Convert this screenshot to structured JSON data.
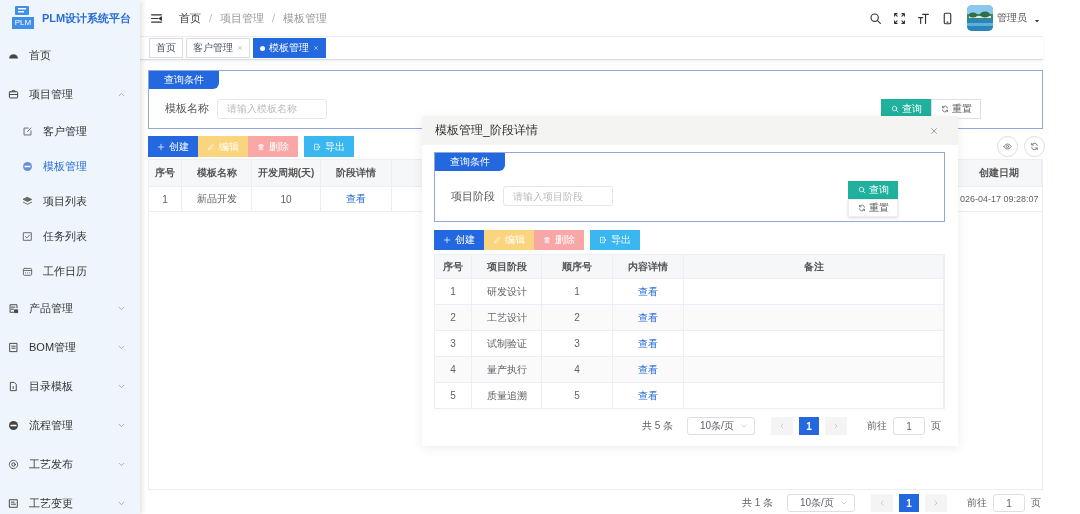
{
  "sidebar": {
    "logo_text": "PLM",
    "title": "PLM设计系统平台",
    "items": [
      {
        "label": "首页",
        "kind": "link",
        "selected": false
      },
      {
        "label": "项目管理",
        "kind": "group",
        "selected": false,
        "expanded": true,
        "children": [
          {
            "label": "客户管理",
            "selected": false
          },
          {
            "label": "模板管理",
            "selected": true
          },
          {
            "label": "项目列表",
            "selected": false
          },
          {
            "label": "任务列表",
            "selected": false
          },
          {
            "label": "工作日历",
            "selected": false
          }
        ]
      },
      {
        "label": "产品管理",
        "kind": "group",
        "selected": false,
        "expanded": false
      },
      {
        "label": "BOM管理",
        "kind": "group",
        "selected": false,
        "expanded": false
      },
      {
        "label": "目录模板",
        "kind": "group",
        "selected": false,
        "expanded": false
      },
      {
        "label": "流程管理",
        "kind": "group",
        "selected": false,
        "expanded": false
      },
      {
        "label": "工艺发布",
        "kind": "group",
        "selected": false,
        "expanded": false
      },
      {
        "label": "工艺变更",
        "kind": "group",
        "selected": false,
        "expanded": false
      }
    ]
  },
  "header": {
    "breadcrumb": [
      "首页",
      "项目管理",
      "模板管理"
    ],
    "separator": "/",
    "user": "管理员"
  },
  "tabs": [
    {
      "label": "首页",
      "selected": false,
      "closable": false
    },
    {
      "label": "客户管理",
      "selected": false,
      "closable": true
    },
    {
      "label": "模板管理",
      "selected": true,
      "closable": true
    }
  ],
  "page": {
    "query": {
      "tab": "查询条件",
      "label": "模板名称",
      "placeholder": "请输入模板名称",
      "buttons": [
        {
          "label": "查询",
          "kind": "primary"
        },
        {
          "label": "重置",
          "kind": "default"
        }
      ]
    },
    "toolbar": [
      {
        "label": "创建",
        "kind": "create",
        "disabled": false
      },
      {
        "label": "编辑",
        "kind": "edit",
        "disabled": true
      },
      {
        "label": "删除",
        "kind": "delete",
        "disabled": true
      },
      {
        "label": "导出",
        "kind": "export",
        "disabled": false
      }
    ],
    "table": {
      "columns": [
        {
          "title": "序号",
          "kind": "text"
        },
        {
          "title": "模板名称",
          "kind": "text"
        },
        {
          "title": "开发周期(天)",
          "kind": "text"
        },
        {
          "title": "阶段详情",
          "kind": "link"
        },
        {
          "title": "创建日期",
          "kind": "text"
        }
      ],
      "rows": [
        [
          "1",
          "新品开发",
          "10",
          "查看",
          "026-04-17 09:28:07"
        ]
      ]
    },
    "pagination": {
      "total": "共 1 条",
      "page_size": "10条/页",
      "pages": [
        {
          "label": "1",
          "selected": true
        }
      ],
      "goto_label": "前往",
      "goto_value": "1",
      "page_suffix": "页"
    }
  },
  "modal": {
    "title": "模板管理_阶段详情",
    "query": {
      "tab": "查询条件",
      "label": "项目阶段",
      "placeholder": "请输入项目阶段",
      "buttons": [
        {
          "label": "查询",
          "kind": "primary"
        },
        {
          "label": "重置",
          "kind": "default"
        }
      ]
    },
    "toolbar": [
      {
        "label": "创建",
        "kind": "create",
        "disabled": false
      },
      {
        "label": "编辑",
        "kind": "edit",
        "disabled": true
      },
      {
        "label": "删除",
        "kind": "delete",
        "disabled": true
      },
      {
        "label": "导出",
        "kind": "export",
        "disabled": false
      }
    ],
    "table": {
      "columns": [
        {
          "title": "序号",
          "kind": "text"
        },
        {
          "title": "项目阶段",
          "kind": "text"
        },
        {
          "title": "顺序号",
          "kind": "text"
        },
        {
          "title": "内容详情",
          "kind": "link"
        },
        {
          "title": "备注",
          "kind": "text"
        }
      ],
      "rows": [
        [
          "1",
          "研发设计",
          "1",
          "查看",
          ""
        ],
        [
          "2",
          "工艺设计",
          "2",
          "查看",
          ""
        ],
        [
          "3",
          "试制验证",
          "3",
          "查看",
          ""
        ],
        [
          "4",
          "量产执行",
          "4",
          "查看",
          ""
        ],
        [
          "5",
          "质量追溯",
          "5",
          "查看",
          ""
        ]
      ]
    },
    "pagination": {
      "total": "共 5 条",
      "page_size": "10条/页",
      "pages": [
        {
          "label": "1",
          "selected": true
        }
      ],
      "goto_label": "前往",
      "goto_value": "1",
      "page_suffix": "页"
    }
  }
}
